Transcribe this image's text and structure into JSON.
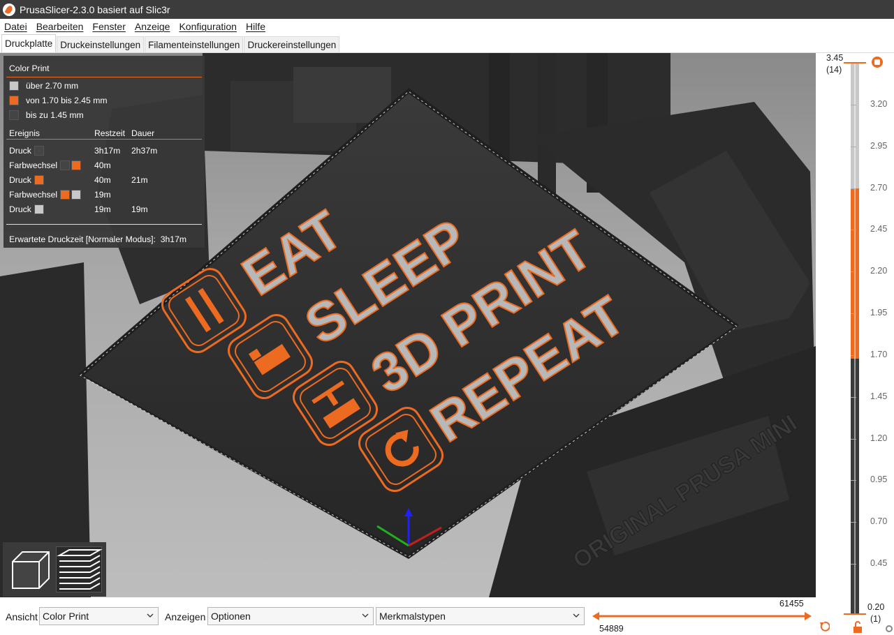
{
  "window": {
    "title": "PrusaSlicer-2.3.0 basiert auf Slic3r"
  },
  "menu": [
    "Datei",
    "Bearbeiten",
    "Fenster",
    "Anzeige",
    "Konfiguration",
    "Hilfe"
  ],
  "tabs": [
    "Druckplatte",
    "Druckeinstellungen",
    "Filamenteinstellungen",
    "Druckereinstellungen"
  ],
  "active_tab": "Druckplatte",
  "colors": {
    "accent": "#ed6b21",
    "light_gray": "#c8c8c8",
    "dark_gray": "#444444",
    "panel": "#383838"
  },
  "legend": {
    "title": "Color Print",
    "ranges": [
      {
        "label": "über 2.70 mm",
        "color": "#c8c8c8"
      },
      {
        "label": "von 1.70 bis 2.45 mm",
        "color": "#ed6b21"
      },
      {
        "label": "bis zu 1.45 mm",
        "color": "#444444"
      }
    ],
    "headers": {
      "event": "Ereignis",
      "remaining": "Restzeit",
      "duration": "Dauer"
    },
    "events": [
      {
        "label": "Druck",
        "colors": [
          "#444444"
        ],
        "remaining": "3h17m",
        "duration": "2h37m"
      },
      {
        "label": "Farbwechsel",
        "colors": [
          "#444444",
          "#ed6b21"
        ],
        "remaining": "40m",
        "duration": ""
      },
      {
        "label": "Druck",
        "colors": [
          "#ed6b21"
        ],
        "remaining": "40m",
        "duration": "21m"
      },
      {
        "label": "Farbwechsel",
        "colors": [
          "#ed6b21",
          "#c8c8c8"
        ],
        "remaining": "19m",
        "duration": ""
      },
      {
        "label": "Druck",
        "colors": [
          "#c8c8c8"
        ],
        "remaining": "19m",
        "duration": "19m"
      }
    ],
    "estimate_label": "Erwartete Druckzeit [Normaler Modus]:",
    "estimate_value": "3h17m"
  },
  "model_text": [
    "EAT",
    "SLEEP",
    "3D PRINT",
    "REPEAT"
  ],
  "model_brand": "ORIGINAL PRUSA MINI",
  "view_buttons": [
    {
      "name": "3d-view-icon"
    },
    {
      "name": "preview-layers-icon"
    }
  ],
  "vertical_slider": {
    "top_value": "3.45",
    "top_layer": "(14)",
    "bottom_value": "0.20",
    "bottom_layer": "(1)",
    "ticks": [
      "3.45",
      "3.20",
      "2.95",
      "2.70",
      "2.45",
      "2.20",
      "1.95",
      "1.70",
      "1.45",
      "1.20",
      "0.95",
      "0.70",
      "0.45",
      "0.20"
    ],
    "color_segments": [
      {
        "from": "3.45",
        "to": "2.70",
        "color": "#c8c8c8"
      },
      {
        "from": "2.70",
        "to": "1.70",
        "color": "#ed6b21"
      },
      {
        "from": "1.70",
        "to": "0.20",
        "color": "#3a3a3a"
      }
    ]
  },
  "bottom_bar": {
    "view_label": "Ansicht",
    "view_value": "Color Print",
    "show_label": "Anzeigen",
    "show_value": "Optionen",
    "feature_value": "Merkmalstypen",
    "h_slider_max": "61455",
    "h_slider_min": "54889"
  }
}
